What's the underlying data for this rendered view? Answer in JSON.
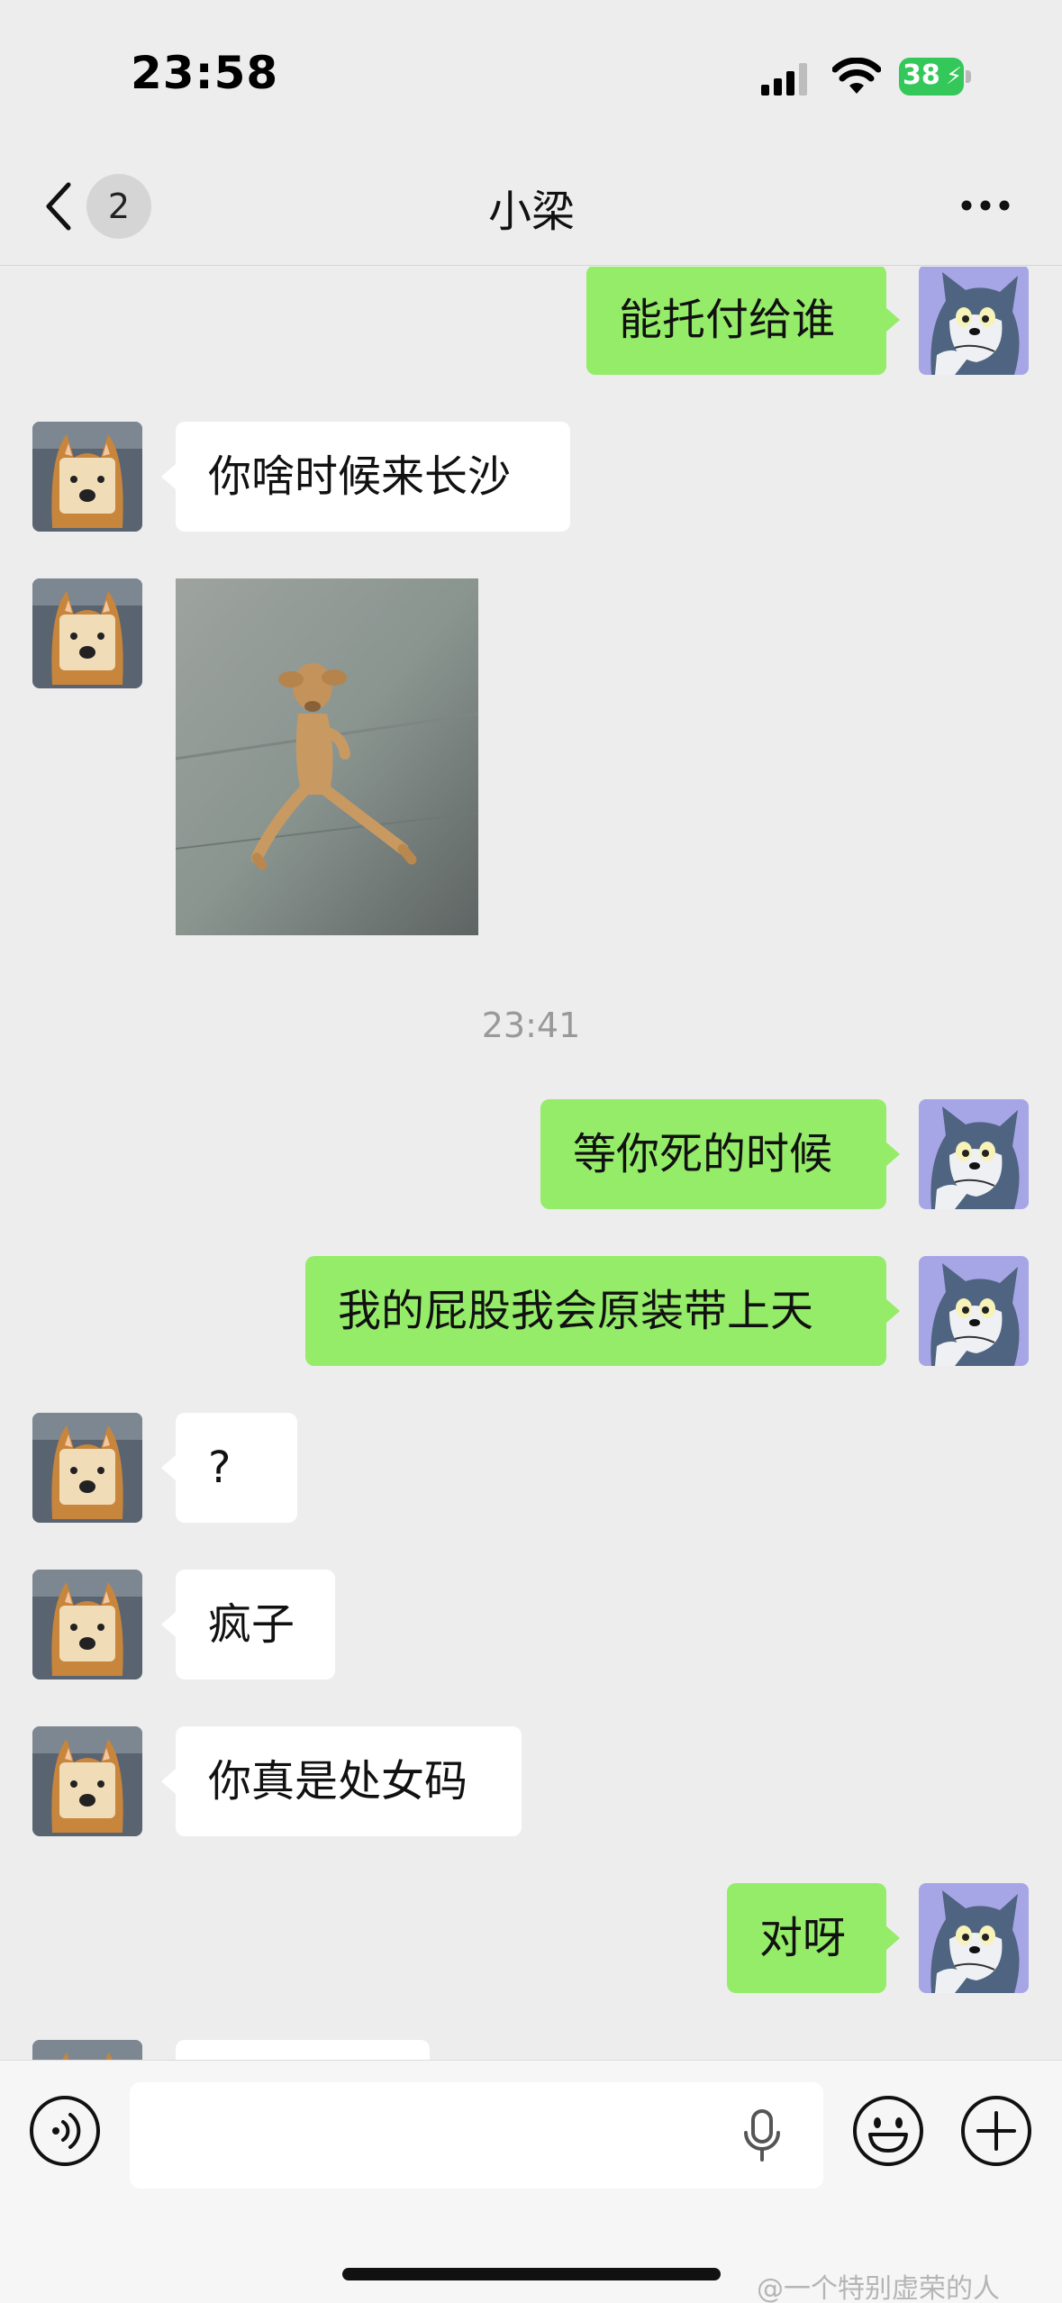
{
  "status_bar": {
    "time": "23:58",
    "battery": "38"
  },
  "nav": {
    "unread_count": "2",
    "title": "小梁"
  },
  "messages": {
    "m1": "能托付给谁",
    "m2": "你啥时候来长沙",
    "timestamp": "23:41",
    "m4": "等你死的时候",
    "m5": "我的屁股我会原装带上天",
    "m6": "?",
    "m7": "疯子",
    "m8": "你真是处女码",
    "m9": "对呀"
  },
  "watermark": "@一个特别虚荣的人",
  "colors": {
    "background": "#ededed",
    "sent_bubble": "#95ec69",
    "received_bubble": "#ffffff",
    "battery": "#34c759"
  },
  "icons": [
    "back-chevron-icon",
    "more-dots-icon",
    "voice-icon",
    "mic-icon",
    "emoji-icon",
    "plus-icon",
    "signal-icon",
    "wifi-icon"
  ]
}
